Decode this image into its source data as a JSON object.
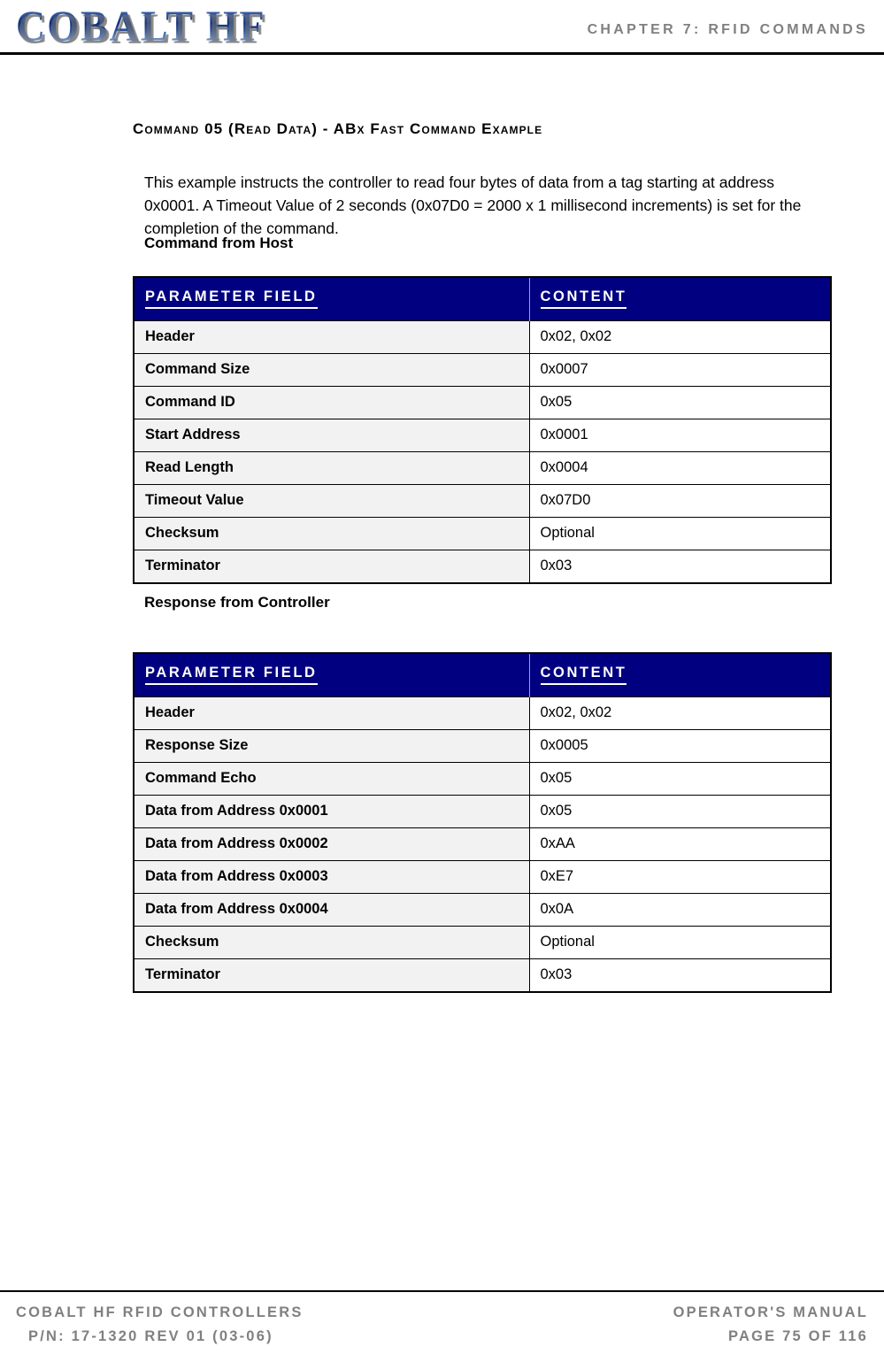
{
  "header": {
    "logo_text": "COBALT HF",
    "chapter": "CHAPTER 7: RFID COMMANDS"
  },
  "main": {
    "section_heading": "Command 05 (Read Data) - ABx Fast Command Example",
    "intro_paragraph": "This example instructs the controller to read four bytes of data from a tag starting at address 0x0001. A Timeout Value of 2 seconds (0x07D0 = 2000 x 1 millisecond increments) is set for the completion of the command.",
    "tables": [
      {
        "caption": "Command from Host",
        "columns": [
          "PARAMETER FIELD",
          "CONTENT"
        ],
        "rows": [
          {
            "field": "Header",
            "content": "0x02, 0x02"
          },
          {
            "field": "Command Size",
            "content": "0x0007"
          },
          {
            "field": "Command ID",
            "content": "0x05"
          },
          {
            "field": "Start Address",
            "content": "0x0001"
          },
          {
            "field": "Read Length",
            "content": "0x0004"
          },
          {
            "field": "Timeout Value",
            "content": "0x07D0"
          },
          {
            "field": "Checksum",
            "content": "Optional"
          },
          {
            "field": "Terminator",
            "content": "0x03"
          }
        ]
      },
      {
        "caption": "Response from Controller",
        "columns": [
          "PARAMETER FIELD",
          "CONTENT"
        ],
        "rows": [
          {
            "field": "Header",
            "content": "0x02, 0x02"
          },
          {
            "field": "Response Size",
            "content": "0x0005"
          },
          {
            "field": "Command Echo",
            "content": "0x05"
          },
          {
            "field": "Data from Address 0x0001",
            "content": "0x05"
          },
          {
            "field": "Data from Address 0x0002",
            "content": "0xAA"
          },
          {
            "field": "Data from Address 0x0003",
            "content": "0xE7"
          },
          {
            "field": "Data from Address 0x0004",
            "content": "0x0A"
          },
          {
            "field": "Checksum",
            "content": "Optional"
          },
          {
            "field": "Terminator",
            "content": "0x03"
          }
        ]
      }
    ]
  },
  "footer": {
    "left_line_1": "COBALT HF RFID CONTROLLERS",
    "left_line_2": "P/N: 17-1320 REV 01 (03-06)",
    "right_line_1": "OPERATOR'S MANUAL",
    "right_line_2": "PAGE 75 OF 116"
  },
  "colors": {
    "table_header_bg": "#000080",
    "table_field_bg": "#f2f2f2",
    "header_footer_text": "#808080",
    "logo_blue": "#1b3f87"
  }
}
